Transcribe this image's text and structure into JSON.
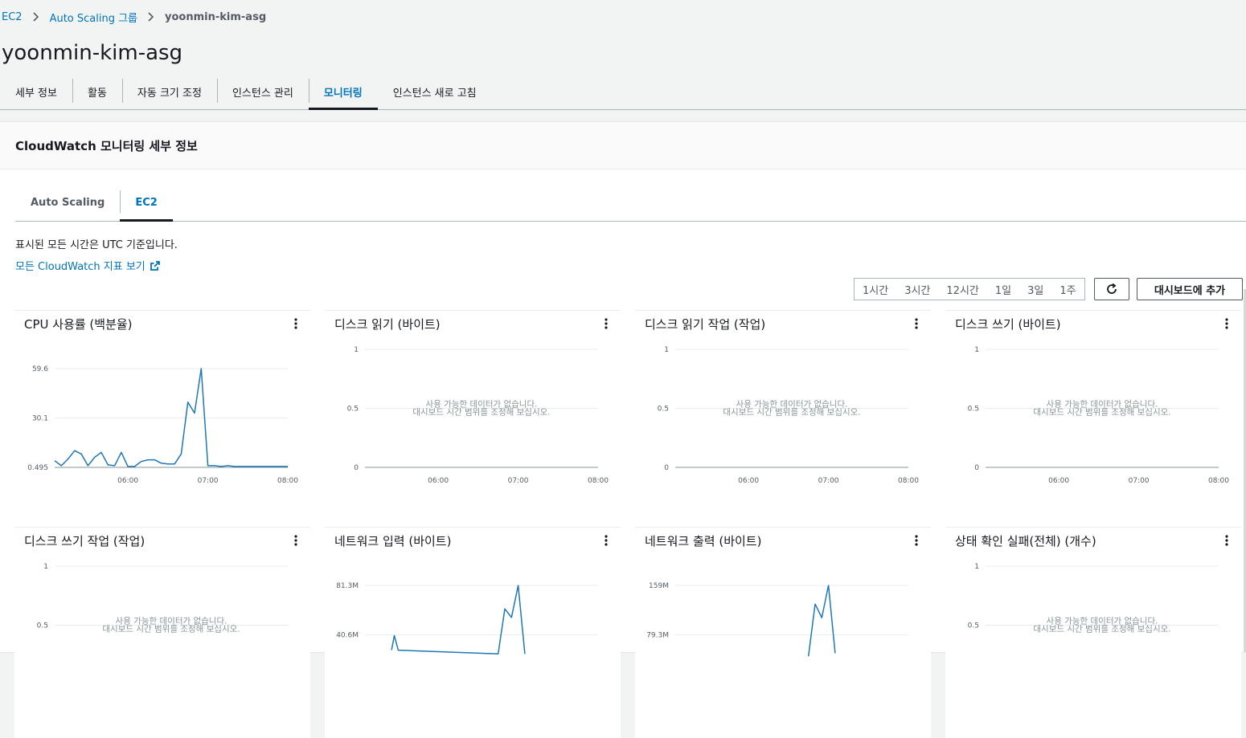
{
  "breadcrumb": [
    {
      "label": "EC2",
      "link": true
    },
    {
      "label": "Auto Scaling 그룹",
      "link": true
    },
    {
      "label": "yoonmin-kim-asg",
      "link": false
    }
  ],
  "page_title": "yoonmin-kim-asg",
  "tabs": [
    {
      "label": "세부 정보",
      "active": false
    },
    {
      "label": "활동",
      "active": false
    },
    {
      "label": "자동 크기 조정",
      "active": false
    },
    {
      "label": "인스턴스 관리",
      "active": false
    },
    {
      "label": "모니터링",
      "active": true
    },
    {
      "label": "인스턴스 새로 고침",
      "active": false
    }
  ],
  "panel": {
    "title": "CloudWatch 모니터링 세부 정보",
    "subtabs": [
      {
        "label": "Auto Scaling",
        "active": false
      },
      {
        "label": "EC2",
        "active": true
      }
    ],
    "utc_note": "표시된 모든 시간은 UTC 기준입니다.",
    "cw_link": "모든 CloudWatch 지표 보기",
    "time_ranges": [
      "1시간",
      "3시간",
      "12시간",
      "1일",
      "3일",
      "1주"
    ],
    "add_dashboard_label": "대시보드에 추가"
  },
  "colors": {
    "accent": "#0073bb",
    "series": "#1f77b4"
  },
  "no_data": {
    "line1": "사용 가능한 데이터가 없습니다.",
    "line2": "대시보드 시간 범위를 조정해 보십시오."
  },
  "chart_data": [
    {
      "type": "line",
      "title": "CPU 사용률 (백분율)",
      "x_ticks": [
        "06:00",
        "07:00",
        "08:00"
      ],
      "y_ticks": [
        "0.495",
        "30.1",
        "59.6"
      ],
      "ylim": [
        0.495,
        59.6
      ],
      "x_range": [
        "05:05",
        "08:00"
      ],
      "series": [
        {
          "x": [
            "05:05",
            "05:10",
            "05:15",
            "05:20",
            "05:25",
            "05:30",
            "05:35",
            "05:40",
            "05:45",
            "05:50",
            "05:55",
            "06:00",
            "06:05",
            "06:10",
            "06:15",
            "06:20",
            "06:25",
            "06:30",
            "06:35",
            "06:40",
            "06:45",
            "06:50",
            "06:55",
            "07:00",
            "07:05",
            "07:10",
            "07:15",
            "07:20",
            "07:25",
            "07:30",
            "07:35",
            "07:40",
            "07:45",
            "07:50",
            "07:55",
            "08:00"
          ],
          "y": [
            4.5,
            1.5,
            5.5,
            10.5,
            8.5,
            1.5,
            6.5,
            9.5,
            2.0,
            1.5,
            9.5,
            1.0,
            1.0,
            4.0,
            5.0,
            5.0,
            3.0,
            2.5,
            2.5,
            8.5,
            39.5,
            33.0,
            59.6,
            1.5,
            1.5,
            1.0,
            1.5,
            1.0,
            1.0,
            1.0,
            1.0,
            1.0,
            1.0,
            1.0,
            1.0,
            1.0
          ]
        }
      ]
    },
    {
      "type": "line",
      "title": "디스크 읽기 (바이트)",
      "x_ticks": [
        "06:00",
        "07:00",
        "08:00"
      ],
      "y_ticks": [
        "0",
        "0.5",
        "1"
      ],
      "ylim": [
        0,
        1
      ],
      "no_data": true,
      "series": []
    },
    {
      "type": "line",
      "title": "디스크 읽기 작업 (작업)",
      "x_ticks": [
        "06:00",
        "07:00",
        "08:00"
      ],
      "y_ticks": [
        "0",
        "0.5",
        "1"
      ],
      "ylim": [
        0,
        1
      ],
      "no_data": true,
      "series": []
    },
    {
      "type": "line",
      "title": "디스크 쓰기 (바이트)",
      "x_ticks": [
        "06:00",
        "07:00",
        "08:00"
      ],
      "y_ticks": [
        "0",
        "0.5",
        "1"
      ],
      "ylim": [
        0,
        1
      ],
      "no_data": true,
      "series": []
    },
    {
      "type": "line",
      "title": "디스크 쓰기 작업 (작업)",
      "x_ticks": [],
      "y_ticks": [
        "0.5",
        "1"
      ],
      "ylim": [
        0,
        1
      ],
      "no_data": true,
      "series": []
    },
    {
      "type": "line",
      "title": "네트워크 입력 (바이트)",
      "x_ticks": [],
      "y_ticks": [
        "40.6M",
        "81.3M"
      ],
      "ylim": [
        0,
        81.3
      ],
      "x_range": [
        "05:05",
        "08:00"
      ],
      "series": [
        {
          "x": [
            "05:25",
            "05:27",
            "05:30",
            "06:45",
            "06:50",
            "06:55",
            "07:00",
            "07:05"
          ],
          "y": [
            28,
            40,
            28,
            25,
            62,
            55,
            81.3,
            25
          ]
        }
      ]
    },
    {
      "type": "line",
      "title": "네트워크 출력 (바이트)",
      "x_ticks": [],
      "y_ticks": [
        "79.3M",
        "159M"
      ],
      "ylim": [
        0,
        159
      ],
      "x_range": [
        "05:05",
        "08:00"
      ],
      "series": [
        {
          "x": [
            "06:45",
            "06:50",
            "06:55",
            "07:00",
            "07:05"
          ],
          "y": [
            45,
            129,
            107,
            159,
            50
          ]
        }
      ]
    },
    {
      "type": "line",
      "title": "상태 확인 실패(전체) (개수)",
      "x_ticks": [],
      "y_ticks": [
        "0.5",
        "1"
      ],
      "ylim": [
        0,
        1
      ],
      "no_data": true,
      "series": []
    }
  ]
}
